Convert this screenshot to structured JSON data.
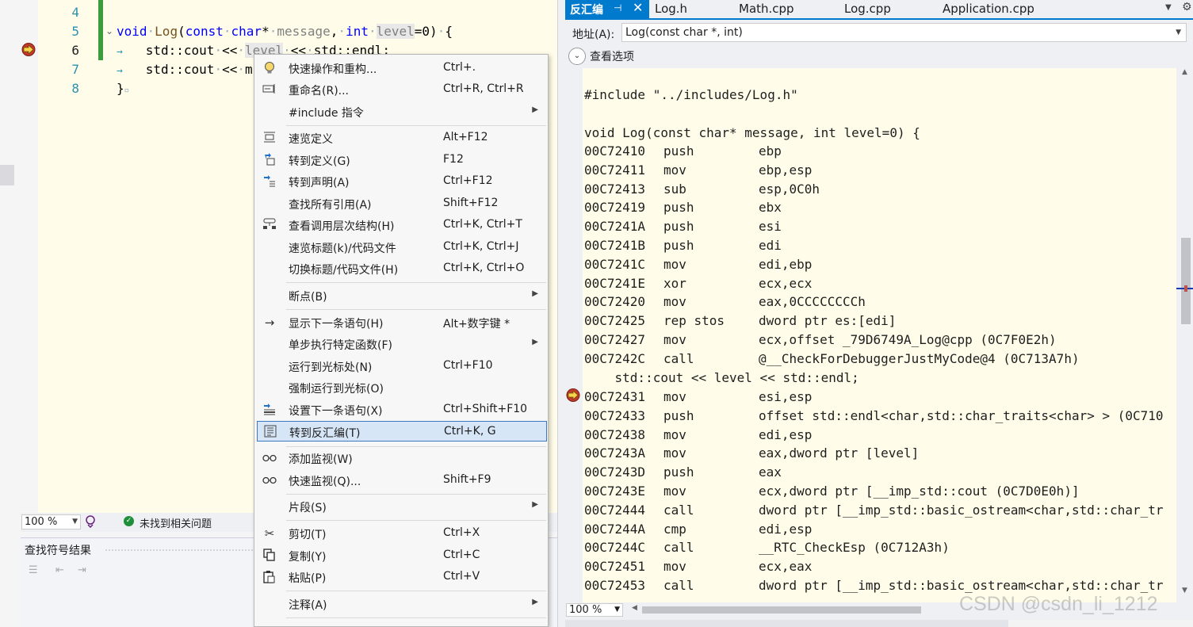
{
  "editor": {
    "lines": [
      {
        "num": "4"
      },
      {
        "num": "5",
        "kw1": "void",
        "name": "Log",
        "open": "(",
        "kw2": "const",
        "kw3": "char",
        "star": "*",
        "p1": "message",
        "comma": ",",
        "kw4": "int",
        "p2": "level",
        "rest": "=0)",
        "brace": "{"
      },
      {
        "num": "6",
        "text": "std::cout",
        "ops": "<<",
        "var": "level",
        "ops2": "<<",
        "tail": "std::endl;"
      },
      {
        "num": "7",
        "text": "std::cout",
        "ops": "<<",
        "tail": "m"
      },
      {
        "num": "8",
        "brace": "}"
      }
    ],
    "status": {
      "zoom": "100 %",
      "issues": "未找到相关问题"
    },
    "find_panel_title": "查找符号结果"
  },
  "context_menu": {
    "items": [
      {
        "label": "快速操作和重构...",
        "shortcut": "Ctrl+.",
        "icon": "lightbulb-icon"
      },
      {
        "label": "重命名(R)...",
        "shortcut": "Ctrl+R, Ctrl+R",
        "icon": "rename-icon"
      },
      {
        "label": "#include 指令",
        "shortcut": "",
        "icon": "",
        "submenu": true
      },
      {
        "label": "速览定义",
        "shortcut": "Alt+F12",
        "icon": "peek-definition-icon"
      },
      {
        "label": "转到定义(G)",
        "shortcut": "F12",
        "icon": "go-to-definition-icon"
      },
      {
        "label": "转到声明(A)",
        "shortcut": "Ctrl+F12",
        "icon": "go-to-declaration-icon"
      },
      {
        "label": "查找所有引用(A)",
        "shortcut": "Shift+F12",
        "icon": ""
      },
      {
        "label": "查看调用层次结构(H)",
        "shortcut": "Ctrl+K, Ctrl+T",
        "icon": "call-hierarchy-icon"
      },
      {
        "label": "速览标题(k)/代码文件",
        "shortcut": "Ctrl+K, Ctrl+J",
        "icon": ""
      },
      {
        "label": "切换标题/代码文件(H)",
        "shortcut": "Ctrl+K, Ctrl+O",
        "icon": ""
      },
      {
        "label": "断点(B)",
        "shortcut": "",
        "icon": "",
        "submenu": true
      },
      {
        "label": "显示下一条语句(H)",
        "shortcut": "Alt+数字键 *",
        "icon": "arrow-right-icon"
      },
      {
        "label": "单步执行特定函数(F)",
        "shortcut": "",
        "icon": "",
        "submenu": true
      },
      {
        "label": "运行到光标处(N)",
        "shortcut": "Ctrl+F10",
        "icon": ""
      },
      {
        "label": "强制运行到光标(O)",
        "shortcut": "",
        "icon": ""
      },
      {
        "label": "设置下一条语句(X)",
        "shortcut": "Ctrl+Shift+F10",
        "icon": "set-next-statement-icon"
      },
      {
        "label": "转到反汇编(T)",
        "shortcut": "Ctrl+K, G",
        "icon": "disassembly-icon"
      },
      {
        "label": "添加监视(W)",
        "shortcut": "",
        "icon": "glasses-icon"
      },
      {
        "label": "快速监视(Q)...",
        "shortcut": "Shift+F9",
        "icon": "glasses-icon"
      },
      {
        "label": "片段(S)",
        "shortcut": "",
        "icon": "",
        "submenu": true
      },
      {
        "label": "剪切(T)",
        "shortcut": "Ctrl+X",
        "icon": "scissors-icon"
      },
      {
        "label": "复制(Y)",
        "shortcut": "Ctrl+C",
        "icon": "copy-icon"
      },
      {
        "label": "粘贴(P)",
        "shortcut": "Ctrl+V",
        "icon": "paste-icon"
      },
      {
        "label": "注释(A)",
        "shortcut": "",
        "icon": "",
        "submenu": true
      }
    ]
  },
  "disasm": {
    "tabs": {
      "active": "反汇编",
      "others": [
        "Log.h",
        "Math.cpp",
        "Log.cpp",
        "Application.cpp"
      ]
    },
    "address_label": "地址(A):",
    "address_value": "Log(const char *, int)",
    "view_options": "查看选项",
    "source_lines": {
      "include": "#include \"../includes/Log.h\"",
      "signature": "void Log(const char* message, int level=0) {",
      "stmt": "    std::cout << level << std::endl;"
    },
    "block1": [
      {
        "addr": "00C72410",
        "op": "push",
        "arg": "ebp"
      },
      {
        "addr": "00C72411",
        "op": "mov",
        "arg": "ebp,esp"
      },
      {
        "addr": "00C72413",
        "op": "sub",
        "arg": "esp,0C0h"
      },
      {
        "addr": "00C72419",
        "op": "push",
        "arg": "ebx"
      },
      {
        "addr": "00C7241A",
        "op": "push",
        "arg": "esi"
      },
      {
        "addr": "00C7241B",
        "op": "push",
        "arg": "edi"
      },
      {
        "addr": "00C7241C",
        "op": "mov",
        "arg": "edi,ebp"
      },
      {
        "addr": "00C7241E",
        "op": "xor",
        "arg": "ecx,ecx"
      },
      {
        "addr": "00C72420",
        "op": "mov",
        "arg": "eax,0CCCCCCCCh"
      },
      {
        "addr": "00C72425",
        "op": "rep stos",
        "arg": "dword ptr es:[edi]"
      },
      {
        "addr": "00C72427",
        "op": "mov",
        "arg": "ecx,offset _79D6749A_Log@cpp (0C7F0E2h)"
      },
      {
        "addr": "00C7242C",
        "op": "call",
        "arg": "@__CheckForDebuggerJustMyCode@4 (0C713A7h)"
      }
    ],
    "block2": [
      {
        "addr": "00C72431",
        "op": "mov",
        "arg": "esi,esp"
      },
      {
        "addr": "00C72433",
        "op": "push",
        "arg": "offset std::endl<char,std::char_traits<char> > (0C710"
      },
      {
        "addr": "00C72438",
        "op": "mov",
        "arg": "edi,esp"
      },
      {
        "addr": "00C7243A",
        "op": "mov",
        "arg": "eax,dword ptr [level]"
      },
      {
        "addr": "00C7243D",
        "op": "push",
        "arg": "eax"
      },
      {
        "addr": "00C7243E",
        "op": "mov",
        "arg": "ecx,dword ptr [__imp_std::cout (0C7D0E0h)]"
      },
      {
        "addr": "00C72444",
        "op": "call",
        "arg": "dword ptr [__imp_std::basic_ostream<char,std::char_tr"
      },
      {
        "addr": "00C7244A",
        "op": "cmp",
        "arg": "edi,esp"
      },
      {
        "addr": "00C7244C",
        "op": "call",
        "arg": "__RTC_CheckEsp (0C712A3h)"
      },
      {
        "addr": "00C72451",
        "op": "mov",
        "arg": "ecx,eax"
      },
      {
        "addr": "00C72453",
        "op": "call",
        "arg": "dword ptr [__imp_std::basic_ostream<char,std::char_tr"
      }
    ],
    "zoom": "100 %"
  },
  "watermark": "CSDN @csdn_li_1212"
}
